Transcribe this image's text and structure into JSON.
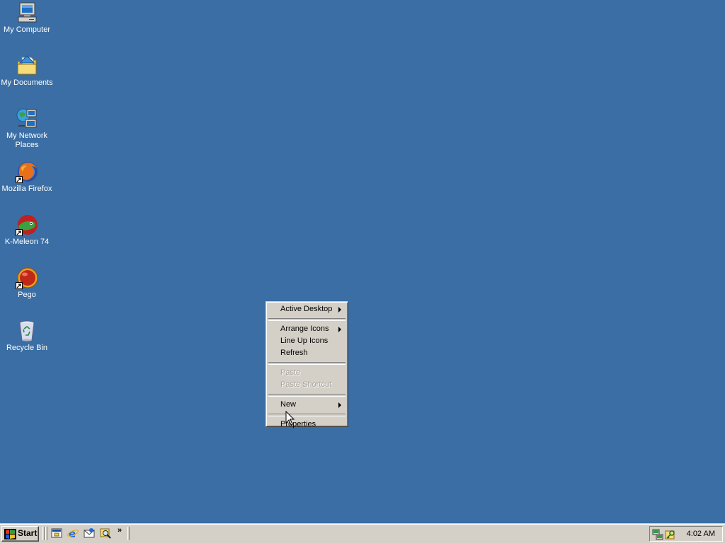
{
  "desktop": {
    "background": "#3a6ea5",
    "icons": [
      {
        "label": "My Computer",
        "icon": "my-computer-icon",
        "shortcut": false
      },
      {
        "label": "My Documents",
        "icon": "my-documents-icon",
        "shortcut": false
      },
      {
        "label": "My Network\nPlaces",
        "icon": "network-places-icon",
        "shortcut": false
      },
      {
        "label": "Mozilla Firefox",
        "icon": "firefox-icon",
        "shortcut": true
      },
      {
        "label": "K-Meleon 74",
        "icon": "kmeleon-icon",
        "shortcut": true
      },
      {
        "label": "Pego",
        "icon": "pego-icon",
        "shortcut": true
      },
      {
        "label": "Recycle Bin",
        "icon": "recycle-bin-icon",
        "shortcut": false
      }
    ]
  },
  "context_menu": {
    "items": [
      {
        "label": "Active Desktop",
        "submenu": true,
        "enabled": true
      },
      {
        "label": "Arrange Icons",
        "submenu": true,
        "enabled": true
      },
      {
        "label": "Line Up Icons",
        "submenu": false,
        "enabled": true
      },
      {
        "label": "Refresh",
        "submenu": false,
        "enabled": true
      },
      {
        "label": "Paste",
        "submenu": false,
        "enabled": false
      },
      {
        "label": "Paste Shortcut",
        "submenu": false,
        "enabled": false
      },
      {
        "label": "New",
        "submenu": true,
        "enabled": true
      },
      {
        "label": "Properties",
        "submenu": false,
        "enabled": true
      }
    ]
  },
  "taskbar": {
    "start_label": "Start",
    "quick_launch": [
      {
        "icon": "show-desktop-icon"
      },
      {
        "icon": "internet-explorer-icon"
      },
      {
        "icon": "outlook-express-icon"
      },
      {
        "icon": "search-icon"
      }
    ],
    "chevron": "»",
    "tray": {
      "icons": [
        "network-tray-icon",
        "key-tray-icon"
      ],
      "clock": "4:02 AM"
    }
  }
}
